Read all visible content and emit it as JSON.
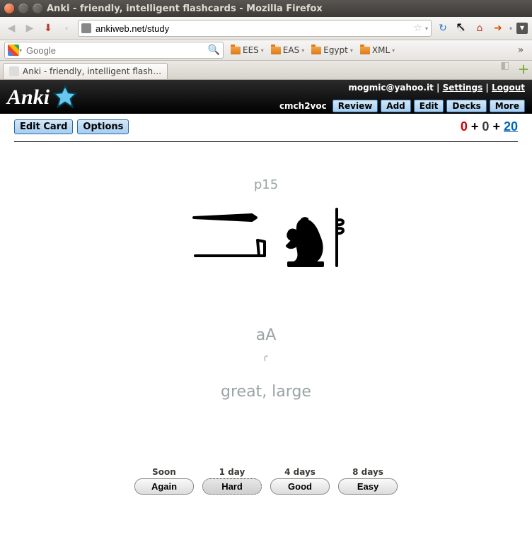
{
  "window": {
    "title": "Anki - friendly, intelligent flashcards - Mozilla Firefox"
  },
  "nav": {
    "url": "ankiweb.net/study"
  },
  "search": {
    "placeholder": "Google"
  },
  "bookmarks": [
    {
      "label": "EES"
    },
    {
      "label": "EAS"
    },
    {
      "label": "Egypt"
    },
    {
      "label": "XML"
    }
  ],
  "tab": {
    "title": "Anki - friendly, intelligent flash…"
  },
  "anki": {
    "logo": "Anki",
    "email": "mogmic@yahoo.it",
    "settings": "Settings",
    "logout": "Logout",
    "deck": "cmch2voc",
    "menu": {
      "review": "Review",
      "add": "Add",
      "edit": "Edit",
      "decks": "Decks",
      "more": "More"
    },
    "editcard": "Edit Card",
    "options": "Options",
    "counts": {
      "a": "0",
      "b": "0",
      "c": "20"
    }
  },
  "card": {
    "ref": "p15",
    "translit": "aA",
    "extra": "ꜥ",
    "meaning": "great, large"
  },
  "answers": [
    {
      "time": "Soon",
      "label": "Again"
    },
    {
      "time": "1 day",
      "label": "Hard"
    },
    {
      "time": "4 days",
      "label": "Good"
    },
    {
      "time": "8 days",
      "label": "Easy"
    }
  ]
}
